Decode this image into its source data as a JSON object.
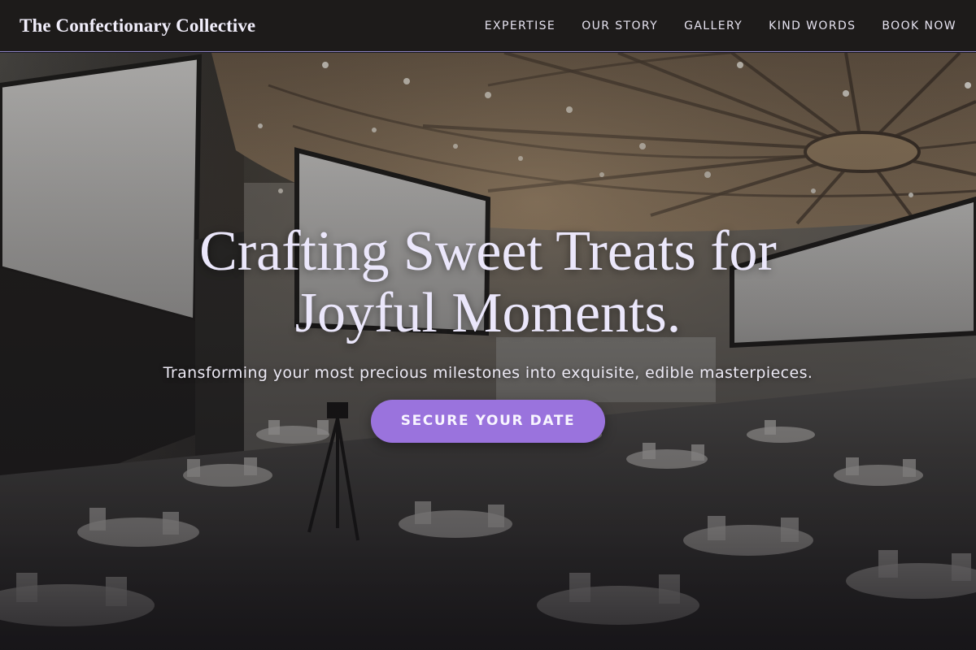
{
  "header": {
    "brand": "The Confectionary Collective",
    "nav": [
      "EXPERTISE",
      "OUR STORY",
      "GALLERY",
      "KIND WORDS",
      "BOOK NOW"
    ]
  },
  "hero": {
    "title_line1": "Crafting Sweet Treats for",
    "title_line2": "Joyful Moments.",
    "subtitle": "Transforming your most precious milestones into exquisite, edible masterpieces.",
    "cta_label": "SECURE YOUR DATE",
    "background": "event-hall-photo"
  },
  "colors": {
    "accent": "#9a73dd",
    "header_bg": "#1d1b1a",
    "header_border": "#8e84c4",
    "title_text": "#ebe7fb"
  }
}
